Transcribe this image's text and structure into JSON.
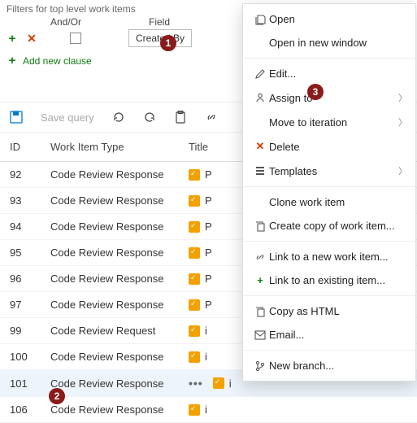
{
  "filters": {
    "label": "Filters for top level work items",
    "andor_header": "And/Or",
    "field_header": "Field",
    "field_value": "Created By",
    "add_clause": "Add new clause"
  },
  "toolbar": {
    "save_label": "Save query"
  },
  "table": {
    "headers": {
      "id": "ID",
      "type": "Work Item Type",
      "title": "Title"
    },
    "rows": [
      {
        "id": "92",
        "type": "Code Review Response",
        "title": "P",
        "sel": false
      },
      {
        "id": "93",
        "type": "Code Review Response",
        "title": "P",
        "sel": false
      },
      {
        "id": "94",
        "type": "Code Review Response",
        "title": "P",
        "sel": false
      },
      {
        "id": "95",
        "type": "Code Review Response",
        "title": "P",
        "sel": false
      },
      {
        "id": "96",
        "type": "Code Review Response",
        "title": "P",
        "sel": false
      },
      {
        "id": "97",
        "type": "Code Review Response",
        "title": "P",
        "sel": false
      },
      {
        "id": "99",
        "type": "Code Review Request",
        "title": "i",
        "sel": false
      },
      {
        "id": "100",
        "type": "Code Review Response",
        "title": "i",
        "sel": false
      },
      {
        "id": "101",
        "type": "Code Review Response",
        "title": "i",
        "sel": true
      },
      {
        "id": "106",
        "type": "Code Review Response",
        "title": "i",
        "sel": false
      }
    ]
  },
  "menu": [
    {
      "kind": "item",
      "icon": "open-icon",
      "label": "Open"
    },
    {
      "kind": "item",
      "icon": "",
      "label": "Open in new window"
    },
    {
      "kind": "sep"
    },
    {
      "kind": "item",
      "icon": "edit-icon",
      "label": "Edit..."
    },
    {
      "kind": "item",
      "icon": "assign-icon",
      "label": "Assign to",
      "sub": true
    },
    {
      "kind": "item",
      "icon": "",
      "label": "Move to iteration",
      "sub": true
    },
    {
      "kind": "item",
      "icon": "delete-icon",
      "label": "Delete",
      "cls": "del"
    },
    {
      "kind": "item",
      "icon": "templates-icon",
      "label": "Templates",
      "sub": true
    },
    {
      "kind": "sep"
    },
    {
      "kind": "item",
      "icon": "",
      "label": "Clone work item"
    },
    {
      "kind": "item",
      "icon": "copy-icon",
      "label": "Create copy of work item..."
    },
    {
      "kind": "sep"
    },
    {
      "kind": "item",
      "icon": "link-icon",
      "label": "Link to a new work item..."
    },
    {
      "kind": "item",
      "icon": "plus-icon",
      "label": "Link to an existing item...",
      "cls": "link-new"
    },
    {
      "kind": "sep"
    },
    {
      "kind": "item",
      "icon": "copy-icon",
      "label": "Copy as HTML"
    },
    {
      "kind": "item",
      "icon": "email-icon",
      "label": "Email..."
    },
    {
      "kind": "sep"
    },
    {
      "kind": "item",
      "icon": "branch-icon",
      "label": "New branch..."
    }
  ],
  "badges": {
    "b1": "1",
    "b2": "2",
    "b3": "3"
  }
}
